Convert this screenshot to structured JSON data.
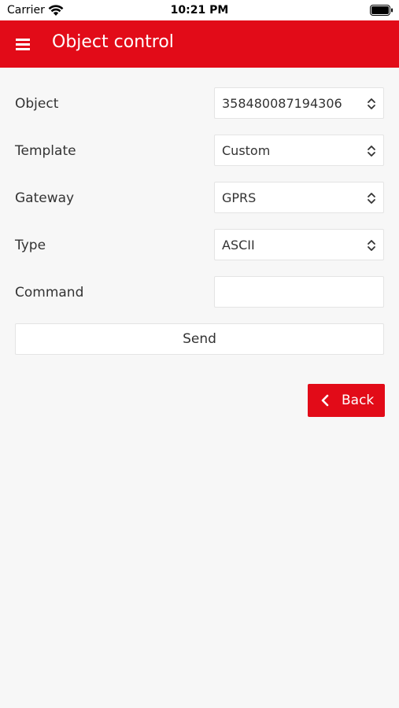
{
  "status_bar": {
    "carrier": "Carrier",
    "time": "10:21 PM"
  },
  "header": {
    "title": "Object control",
    "menu_icon": "hamburger-menu-icon"
  },
  "form": {
    "object": {
      "label": "Object",
      "value": "358480087194306"
    },
    "template": {
      "label": "Template",
      "value": "Custom"
    },
    "gateway": {
      "label": "Gateway",
      "value": "GPRS"
    },
    "type": {
      "label": "Type",
      "value": "ASCII"
    },
    "command": {
      "label": "Command",
      "value": ""
    }
  },
  "actions": {
    "send_label": "Send",
    "back_label": "Back",
    "back_icon": "chevron-left-icon"
  },
  "colors": {
    "accent": "#e20b18",
    "background": "#f7f7f7",
    "field_border": "#e4e4e4"
  }
}
